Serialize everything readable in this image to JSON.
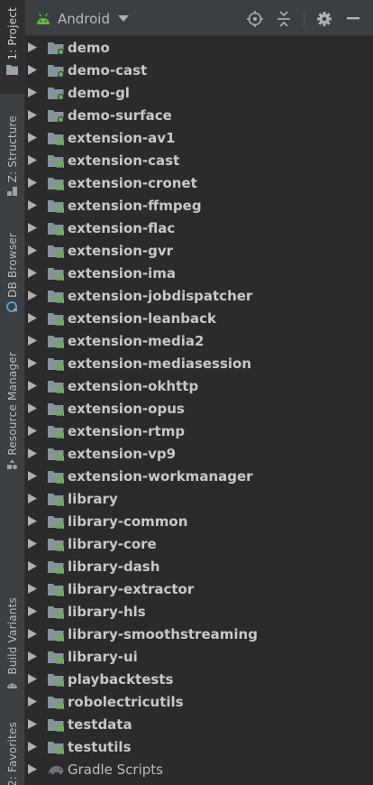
{
  "side_tabs": [
    {
      "label": "1: Project",
      "icon": "folder-icon",
      "active": true
    },
    {
      "label": "Z: Structure",
      "icon": "structure-icon",
      "active": false
    },
    {
      "label": "DB Browser",
      "icon": "db-icon",
      "active": false
    },
    {
      "label": "Resource Manager",
      "icon": "resource-icon",
      "active": false
    },
    {
      "label": "Build Variants",
      "icon": "android-icon",
      "active": false
    },
    {
      "label": "2: Favorites",
      "icon": "star-icon",
      "active": false
    }
  ],
  "header": {
    "view_label": "Android",
    "actions": [
      "locate-icon",
      "collapse-icon",
      "settings-icon",
      "hide-icon"
    ]
  },
  "tree": [
    {
      "label": "demo",
      "kind": "app"
    },
    {
      "label": "demo-cast",
      "kind": "app"
    },
    {
      "label": "demo-gl",
      "kind": "app"
    },
    {
      "label": "demo-surface",
      "kind": "app"
    },
    {
      "label": "extension-av1",
      "kind": "lib"
    },
    {
      "label": "extension-cast",
      "kind": "lib"
    },
    {
      "label": "extension-cronet",
      "kind": "lib"
    },
    {
      "label": "extension-ffmpeg",
      "kind": "lib"
    },
    {
      "label": "extension-flac",
      "kind": "lib"
    },
    {
      "label": "extension-gvr",
      "kind": "lib"
    },
    {
      "label": "extension-ima",
      "kind": "lib"
    },
    {
      "label": "extension-jobdispatcher",
      "kind": "lib"
    },
    {
      "label": "extension-leanback",
      "kind": "lib"
    },
    {
      "label": "extension-media2",
      "kind": "lib"
    },
    {
      "label": "extension-mediasession",
      "kind": "lib"
    },
    {
      "label": "extension-okhttp",
      "kind": "lib"
    },
    {
      "label": "extension-opus",
      "kind": "lib"
    },
    {
      "label": "extension-rtmp",
      "kind": "lib"
    },
    {
      "label": "extension-vp9",
      "kind": "lib"
    },
    {
      "label": "extension-workmanager",
      "kind": "lib"
    },
    {
      "label": "library",
      "kind": "lib"
    },
    {
      "label": "library-common",
      "kind": "lib"
    },
    {
      "label": "library-core",
      "kind": "lib"
    },
    {
      "label": "library-dash",
      "kind": "lib"
    },
    {
      "label": "library-extractor",
      "kind": "lib"
    },
    {
      "label": "library-hls",
      "kind": "lib"
    },
    {
      "label": "library-smoothstreaming",
      "kind": "lib"
    },
    {
      "label": "library-ui",
      "kind": "lib"
    },
    {
      "label": "playbacktests",
      "kind": "lib"
    },
    {
      "label": "robolectricutils",
      "kind": "lib"
    },
    {
      "label": "testdata",
      "kind": "lib"
    },
    {
      "label": "testutils",
      "kind": "lib"
    },
    {
      "label": "Gradle Scripts",
      "kind": "gradle"
    }
  ],
  "colors": {
    "panel_bg": "#2b2b2b",
    "strip_bg": "#3c3f41",
    "folder": "#87939a",
    "app_dot": "#62b543",
    "lib_bars": "#62b543",
    "text": "#c8c8c8"
  }
}
